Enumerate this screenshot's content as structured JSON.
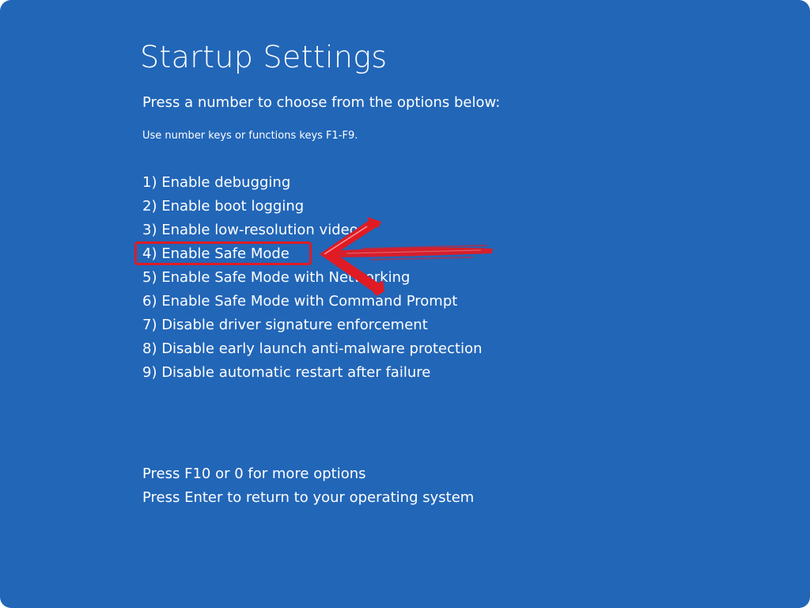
{
  "screen": {
    "title": "Startup Settings",
    "instruction": "Press a number to choose from the options below:",
    "hint": "Use number keys or functions keys F1-F9.",
    "options": [
      {
        "label": "1) Enable debugging"
      },
      {
        "label": "2) Enable boot logging"
      },
      {
        "label": "3) Enable low-resolution video"
      },
      {
        "label": "4) Enable Safe Mode",
        "highlighted": true
      },
      {
        "label": "5) Enable Safe Mode with Networking"
      },
      {
        "label": "6) Enable Safe Mode with Command Prompt"
      },
      {
        "label": "7) Disable driver signature enforcement"
      },
      {
        "label": "8) Disable early launch anti-malware protection"
      },
      {
        "label": "9) Disable automatic restart after failure"
      }
    ],
    "footer": {
      "more_options": "Press F10 or 0 for more options",
      "return": "Press Enter to return to your operating system"
    }
  },
  "annotation": {
    "color": "#e01b24",
    "icon": "red-arrow-icon"
  },
  "colors": {
    "background": "#2266b8",
    "text": "#ffffff"
  }
}
